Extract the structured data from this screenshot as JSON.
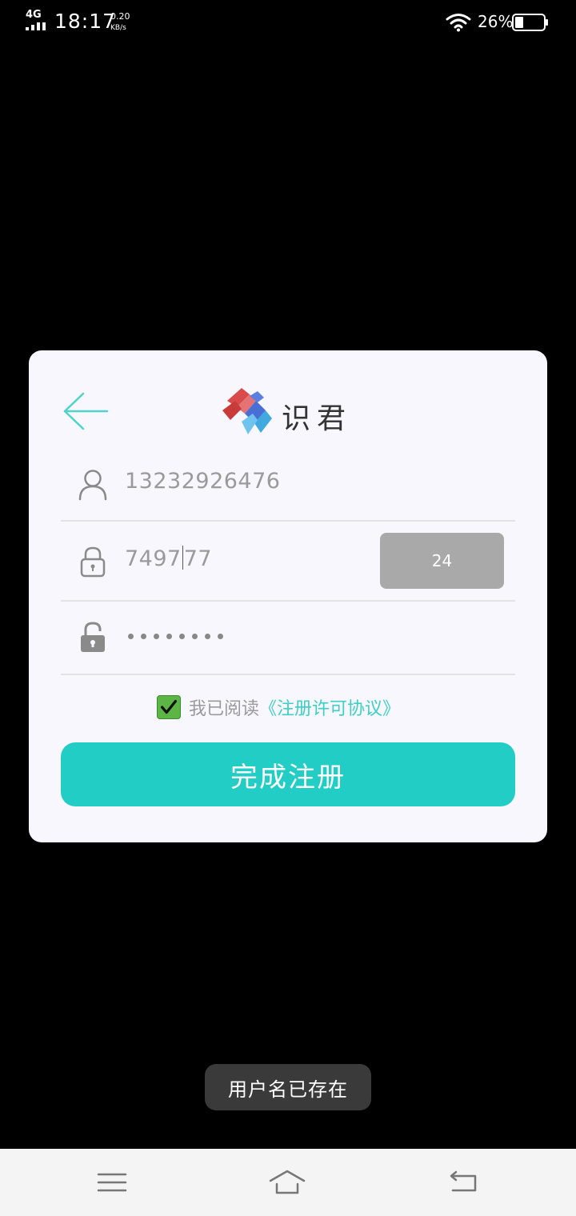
{
  "status_bar": {
    "network": "4G",
    "time": "18:17",
    "speed_value": "0.20",
    "speed_unit": "KB/s",
    "battery_percent": "26%"
  },
  "dialog": {
    "back_icon": "arrow-left-icon",
    "logo_text": "识君",
    "phone": {
      "icon": "user-icon",
      "value": "13232926476"
    },
    "code": {
      "icon": "lock-closed-icon",
      "value_before_caret": "7497",
      "value_after_caret": "77",
      "button_label": "24"
    },
    "password": {
      "icon": "lock-open-icon",
      "masked_length": 8
    },
    "agreement": {
      "checked": true,
      "text": "我已阅读",
      "link": "《注册许可协议》"
    },
    "submit_label": "完成注册"
  },
  "toast": {
    "message": "用户名已存在"
  },
  "nav_bar": {
    "items": [
      {
        "icon": "menu-icon"
      },
      {
        "icon": "home-icon"
      },
      {
        "icon": "back-icon"
      }
    ]
  },
  "colors": {
    "accent": "#22cdc5",
    "link": "#3ccfc8",
    "code_button": "#a9a9a9",
    "checkbox": "#5cb646",
    "dialog_bg": "#f8f7fd"
  }
}
